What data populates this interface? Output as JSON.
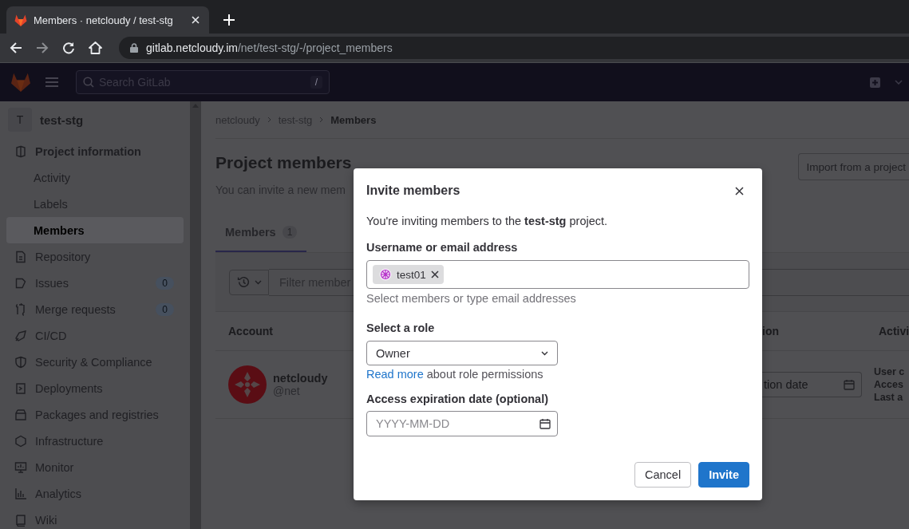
{
  "browser": {
    "tab_title": "Members · netcloudy / test-stg",
    "url_host": "gitlab.netcloudy.im",
    "url_path": "/net/test-stg/-/project_members"
  },
  "header": {
    "search_placeholder": "Search GitLab",
    "shortcut": "/"
  },
  "sidebar": {
    "project_initial": "T",
    "project_name": "test-stg",
    "items": [
      {
        "label": "Project information",
        "expanded": true,
        "selected": false,
        "children": [
          {
            "label": "Activity",
            "selected": false
          },
          {
            "label": "Labels",
            "selected": false
          },
          {
            "label": "Members",
            "selected": true
          }
        ]
      },
      {
        "label": "Repository",
        "selected": false
      },
      {
        "label": "Issues",
        "selected": false,
        "badge": "0"
      },
      {
        "label": "Merge requests",
        "selected": false,
        "badge": "0"
      },
      {
        "label": "CI/CD",
        "selected": false
      },
      {
        "label": "Security & Compliance",
        "selected": false
      },
      {
        "label": "Deployments",
        "selected": false
      },
      {
        "label": "Packages and registries",
        "selected": false
      },
      {
        "label": "Infrastructure",
        "selected": false
      },
      {
        "label": "Monitor",
        "selected": false
      },
      {
        "label": "Analytics",
        "selected": false
      },
      {
        "label": "Wiki",
        "selected": false
      }
    ]
  },
  "breadcrumbs": [
    "netcloudy",
    "test-stg",
    "Members"
  ],
  "page": {
    "title": "Project members",
    "subtitle": "You can invite a new mem",
    "import_button": "Import from a project",
    "tabs": [
      {
        "label": "Members",
        "count": "1",
        "selected": true
      }
    ],
    "filter_placeholder": "Filter member",
    "columns": [
      "Account",
      "ion",
      "Activi"
    ],
    "rows": [
      {
        "name": "netcloudy",
        "username": "@net",
        "expiration_placeholder": "tion date",
        "activity": [
          "User c",
          "Acces",
          "Last a"
        ]
      }
    ]
  },
  "modal": {
    "title": "Invite members",
    "intro": "You're inviting members to the **test-stg** project.",
    "username_label": "Username or email address",
    "tokens": [
      {
        "label": "test01"
      }
    ],
    "username_hint": "Select members or type email addresses",
    "role_label": "Select a role",
    "role_value": "Owner",
    "read_more_link": "Read more",
    "read_more_text": "about role permissions",
    "date_label": "Access expiration date (optional)",
    "date_placeholder": "YYYY-MM-DD",
    "cancel_button": "Cancel",
    "invite_button": "Invite"
  }
}
